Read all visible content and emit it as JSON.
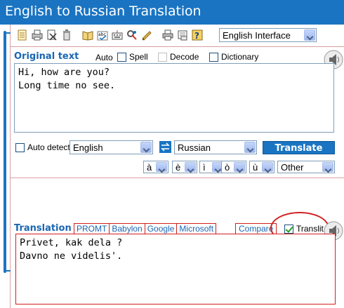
{
  "title": "English to Russian Translation",
  "toolbar": {
    "icons": [
      "notepad-icon",
      "print-preview-icon",
      "cut-icon",
      "delete-icon",
      "dictionary-book-icon",
      "spellcheck-icon",
      "keyboard-icon",
      "tools-icon",
      "edit-icon",
      "print-icon",
      "email-icon",
      "help-icon"
    ],
    "interface_select": "English Interface"
  },
  "original": {
    "label": "Original text",
    "options": {
      "auto": "Auto",
      "spell": "Spell",
      "decode": "Decode",
      "dictionary": "Dictionary"
    },
    "text": "Hi, how are you?\nLong time no see."
  },
  "controls": {
    "auto_detect": "Auto detect",
    "source_lang": "English",
    "target_lang": "Russian",
    "translate_button": "Translate",
    "accent_chars": [
      "à",
      "è",
      "ì",
      "ò",
      "ù"
    ],
    "other": "Other"
  },
  "translation": {
    "label": "Translation",
    "tabs": [
      "PROMT",
      "Babylon",
      "Google",
      "Microsoft"
    ],
    "active_tab": "PROMT",
    "compare": "Compare",
    "translit": "Translit",
    "translit_checked": true,
    "text": "Privet, kak dela ?\nDavno ne videlis'."
  },
  "colors": {
    "accent": "#1a74c2",
    "highlight": "#d11f1f",
    "label": "#1a66b3"
  }
}
